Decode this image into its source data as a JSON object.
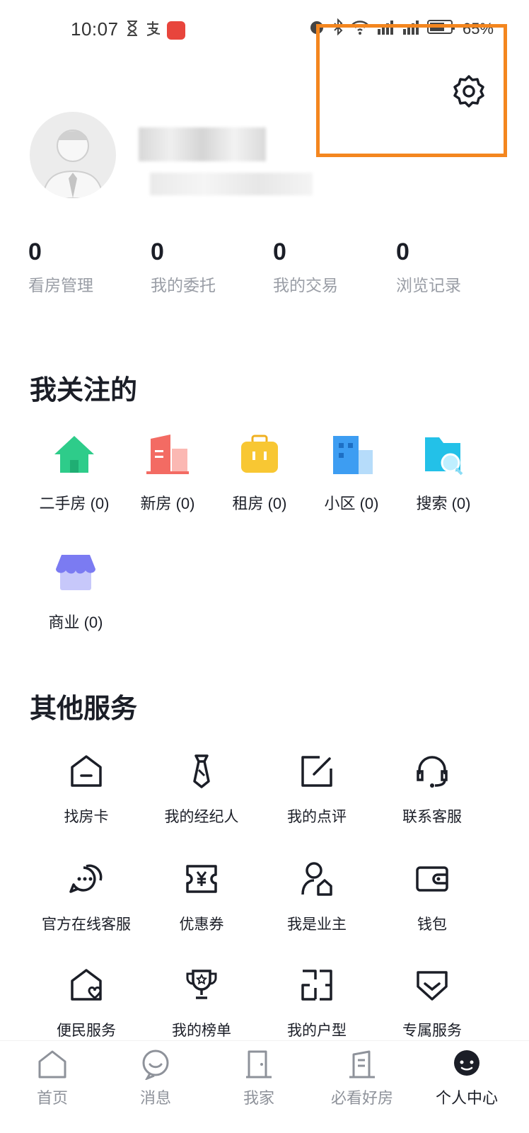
{
  "status_bar": {
    "time": "10:07",
    "battery": "65%"
  },
  "stats": [
    {
      "value": "0",
      "label": "看房管理"
    },
    {
      "value": "0",
      "label": "我的委托"
    },
    {
      "value": "0",
      "label": "我的交易"
    },
    {
      "value": "0",
      "label": "浏览记录"
    }
  ],
  "following": {
    "title": "我关注的",
    "items": [
      {
        "label": "二手房 (0)",
        "icon": "house-icon",
        "color": "#2ecc8a"
      },
      {
        "label": "新房 (0)",
        "icon": "building-icon",
        "color": "#f36b63"
      },
      {
        "label": "租房 (0)",
        "icon": "suitcase-icon",
        "color": "#f8c733"
      },
      {
        "label": "小区 (0)",
        "icon": "community-icon",
        "color": "#3d9df2"
      },
      {
        "label": "搜索 (0)",
        "icon": "search-folder-icon",
        "color": "#23c1e8"
      },
      {
        "label": "商业 (0)",
        "icon": "shop-icon",
        "color": "#7b7bf2"
      }
    ]
  },
  "services": {
    "title": "其他服务",
    "items": [
      {
        "label": "找房卡",
        "icon": "house-card-icon"
      },
      {
        "label": "我的经纪人",
        "icon": "tie-icon"
      },
      {
        "label": "我的点评",
        "icon": "edit-icon"
      },
      {
        "label": "联系客服",
        "icon": "headset-icon"
      },
      {
        "label": "官方在线客服",
        "icon": "chat-icon"
      },
      {
        "label": "优惠券",
        "icon": "coupon-icon"
      },
      {
        "label": "我是业主",
        "icon": "owner-icon"
      },
      {
        "label": "钱包",
        "icon": "wallet-icon"
      },
      {
        "label": "便民服务",
        "icon": "heart-house-icon"
      },
      {
        "label": "我的榜单",
        "icon": "trophy-icon"
      },
      {
        "label": "我的户型",
        "icon": "floorplan-icon"
      },
      {
        "label": "专属服务",
        "icon": "diamond-icon"
      }
    ]
  },
  "bottom_nav": [
    {
      "label": "首页",
      "icon": "home-icon"
    },
    {
      "label": "消息",
      "icon": "message-icon"
    },
    {
      "label": "我家",
      "icon": "door-icon"
    },
    {
      "label": "必看好房",
      "icon": "building-outline-icon"
    },
    {
      "label": "个人中心",
      "icon": "profile-icon",
      "active": true
    }
  ],
  "colors": {
    "highlight": "#f4861f",
    "text": "#1b1e27",
    "muted": "#9a9ea6"
  }
}
